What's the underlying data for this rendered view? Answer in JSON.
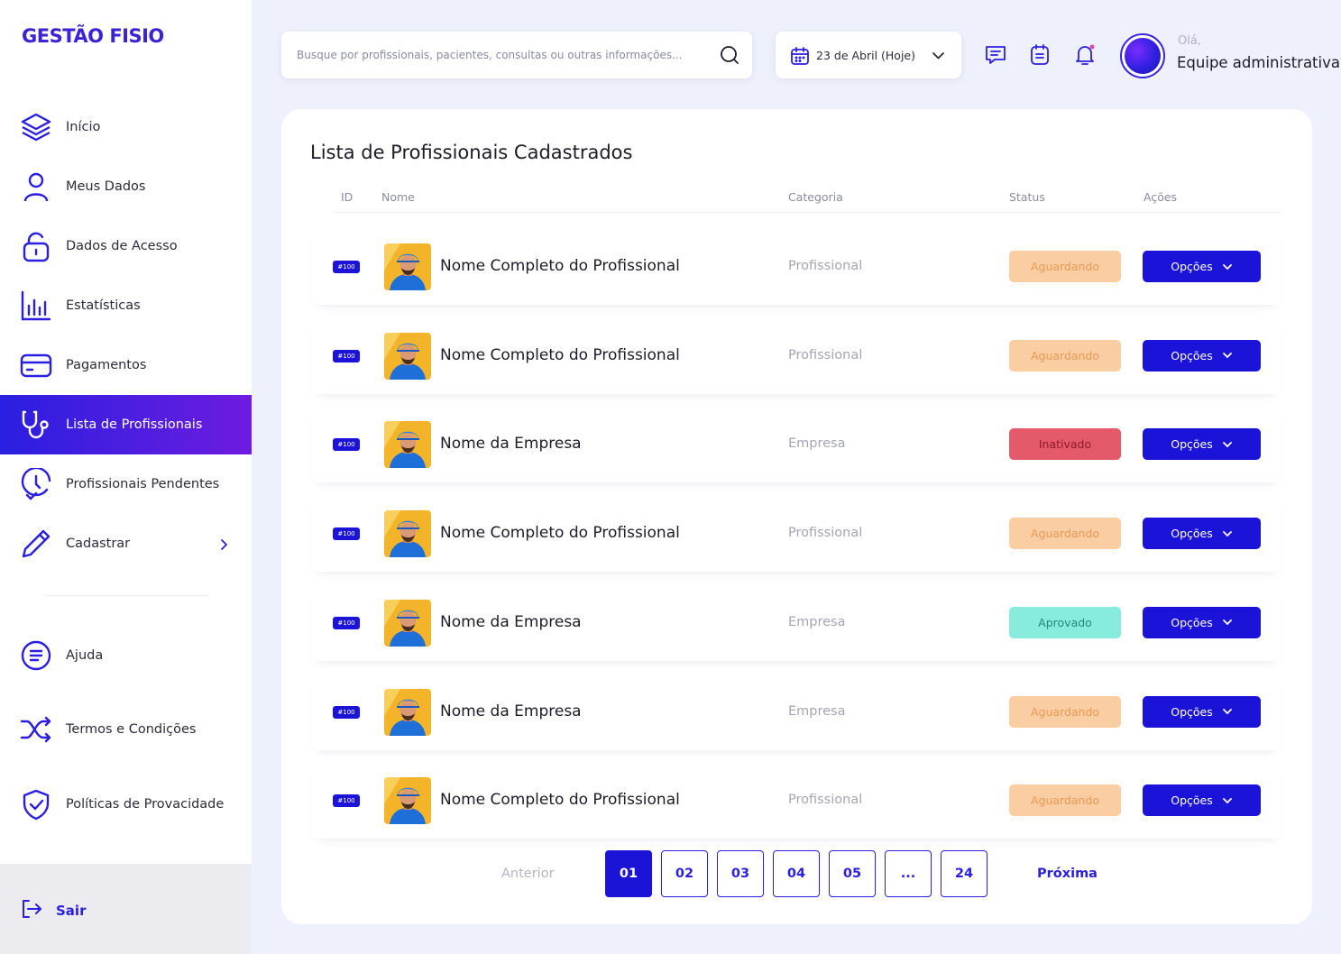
{
  "app": {
    "logo": "GESTÃO FISIO"
  },
  "colors": {
    "accent": "#1b14d8",
    "accent_purple": "#6d1ce0",
    "waiting": "#fbcda3",
    "inactive": "#e55a6a",
    "approved": "#88ecdc"
  },
  "sidebar": {
    "items": [
      {
        "label": "Início",
        "icon": "layers-icon",
        "active": false
      },
      {
        "label": "Meus Dados",
        "icon": "user-icon",
        "active": false
      },
      {
        "label": "Dados de Acesso",
        "icon": "unlock-icon",
        "active": false
      },
      {
        "label": "Estatísticas",
        "icon": "bar-chart-icon",
        "active": false
      },
      {
        "label": "Pagamentos",
        "icon": "credit-card-icon",
        "active": false
      },
      {
        "label": "Lista de Profissionais",
        "icon": "stethoscope-icon",
        "active": true
      },
      {
        "label": "Profissionais Pendentes",
        "icon": "clock-check-icon",
        "active": false
      },
      {
        "label": "Cadastrar",
        "icon": "pencil-icon",
        "active": false
      }
    ],
    "secondary": [
      {
        "label": "Ajuda",
        "icon": "help-list-icon"
      },
      {
        "label": "Termos e Condições",
        "icon": "shuffle-icon"
      },
      {
        "label": "Políticas de Provacidade",
        "icon": "shield-check-icon"
      }
    ],
    "logout_label": "Sair"
  },
  "topbar": {
    "search_placeholder": "Busque por profissionais, pacientes, consultas ou outras informações...",
    "date_label": "23 de Abril (Hoje)",
    "greeting": "Olá,",
    "user_name": "Equipe administrativa"
  },
  "main": {
    "title": "Lista de Profissionais Cadastrados",
    "columns": {
      "id": "ID",
      "name": "Nome",
      "category": "Categoria",
      "status": "Status",
      "actions": "Ações"
    },
    "options_label": "Opções",
    "rows": [
      {
        "id": "#100",
        "name": "Nome Completo do Profissional",
        "category": "Profissional",
        "status": "Aguardando",
        "status_type": "wait"
      },
      {
        "id": "#100",
        "name": "Nome Completo do Profissional",
        "category": "Profissional",
        "status": "Aguardando",
        "status_type": "wait"
      },
      {
        "id": "#100",
        "name": "Nome da Empresa",
        "category": "Empresa",
        "status": "Inativado",
        "status_type": "inact"
      },
      {
        "id": "#100",
        "name": "Nome Completo do Profissional",
        "category": "Profissional",
        "status": "Aguardando",
        "status_type": "wait"
      },
      {
        "id": "#100",
        "name": "Nome da Empresa",
        "category": "Empresa",
        "status": "Aprovado",
        "status_type": "ok"
      },
      {
        "id": "#100",
        "name": "Nome da Empresa",
        "category": "Empresa",
        "status": "Aguardando",
        "status_type": "wait"
      },
      {
        "id": "#100",
        "name": "Nome Completo do Profissional",
        "category": "Profissional",
        "status": "Aguardando",
        "status_type": "wait"
      }
    ]
  },
  "pagination": {
    "prev": "Anterior",
    "next": "Próxima",
    "pages": [
      "01",
      "02",
      "03",
      "04",
      "05",
      "...",
      "24"
    ],
    "current": "01"
  }
}
